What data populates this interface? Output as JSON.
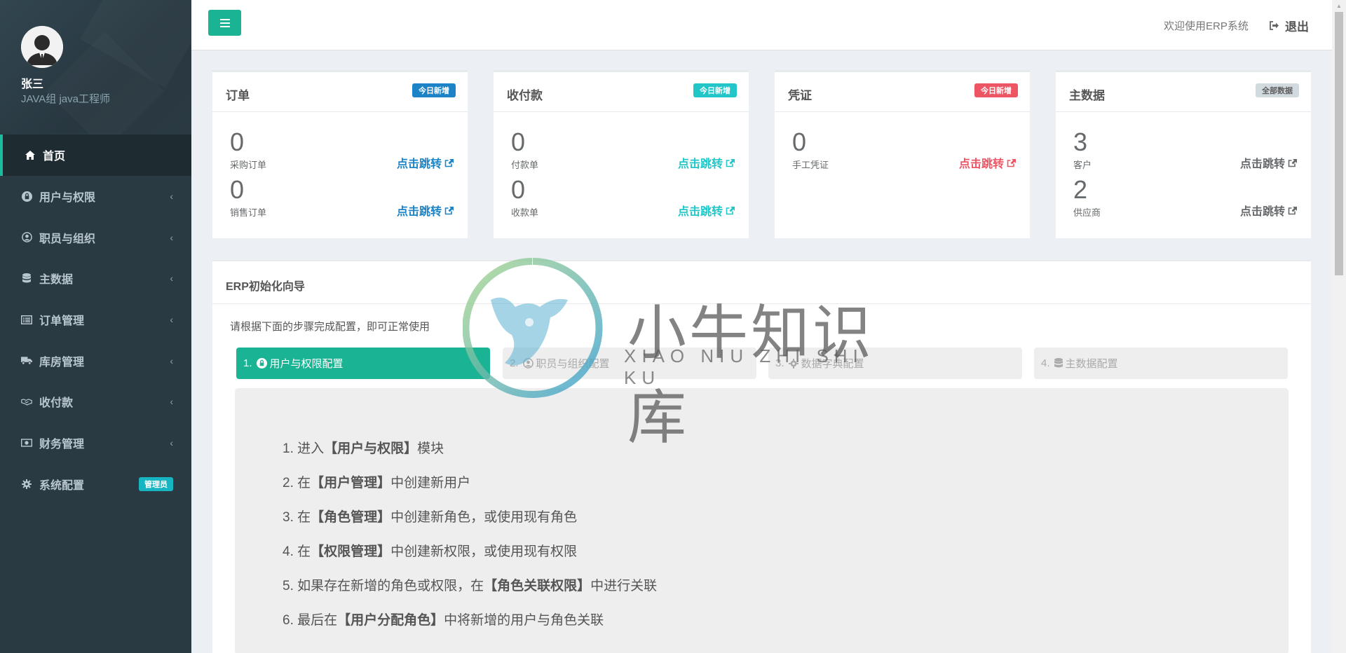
{
  "user": {
    "name": "张三",
    "role": "JAVA组 java工程师"
  },
  "sidebar": {
    "items": [
      {
        "label": "首页",
        "icon": "home-icon",
        "active": true
      },
      {
        "label": "用户与权限",
        "icon": "lock-icon"
      },
      {
        "label": "职员与组织",
        "icon": "user-circle-icon"
      },
      {
        "label": "主数据",
        "icon": "database-icon"
      },
      {
        "label": "订单管理",
        "icon": "list-alt-icon"
      },
      {
        "label": "库房管理",
        "icon": "truck-icon"
      },
      {
        "label": "收付款",
        "icon": "handshake-icon"
      },
      {
        "label": "财务管理",
        "icon": "money-icon"
      },
      {
        "label": "系统配置",
        "icon": "gear-icon",
        "badge": "管理员"
      }
    ]
  },
  "header": {
    "welcome": "欢迎使用ERP系统",
    "logout": "退出"
  },
  "boxes": [
    {
      "title": "订单",
      "badge": "今日新增",
      "badge_color": "#1c84c6",
      "link_color": "#1c84c6",
      "stats": [
        {
          "num": "0",
          "label": "采购订单",
          "link": "点击跳转"
        },
        {
          "num": "0",
          "label": "销售订单",
          "link": "点击跳转"
        }
      ]
    },
    {
      "title": "收付款",
      "badge": "今日新增",
      "badge_color": "#23c6c8",
      "link_color": "#23c6c8",
      "stats": [
        {
          "num": "0",
          "label": "付款单",
          "link": "点击跳转"
        },
        {
          "num": "0",
          "label": "收款单",
          "link": "点击跳转"
        }
      ]
    },
    {
      "title": "凭证",
      "badge": "今日新增",
      "badge_color": "#ed5565",
      "link_color": "#ed5565",
      "stats": [
        {
          "num": "0",
          "label": "手工凭证",
          "link": "点击跳转"
        }
      ]
    },
    {
      "title": "主数据",
      "badge": "全部数据",
      "badge_color": "#d1dade",
      "link_color": "#676a6c",
      "stats": [
        {
          "num": "3",
          "label": "客户",
          "link": "点击跳转"
        },
        {
          "num": "2",
          "label": "供应商",
          "link": "点击跳转"
        }
      ]
    }
  ],
  "wizard": {
    "title": "ERP初始化向导",
    "desc": "请根据下面的步骤完成配置，即可正常使用",
    "steps": [
      {
        "num": "1.",
        "label": "用户与权限配置",
        "icon": "lock-icon"
      },
      {
        "num": "2.",
        "label": "职员与组织配置",
        "icon": "user-circle-icon"
      },
      {
        "num": "3.",
        "label": "数据字典配置",
        "icon": "gear-icon"
      },
      {
        "num": "4.",
        "label": "主数据配置",
        "icon": "database-icon"
      }
    ],
    "instructions": [
      {
        "pre": "1. 进入",
        "bold": "【用户与权限】",
        "post": "模块"
      },
      {
        "pre": "2. 在",
        "bold": "【用户管理】",
        "post": "中创建新用户"
      },
      {
        "pre": "3. 在",
        "bold": "【角色管理】",
        "post": "中创建新角色，或使用现有角色"
      },
      {
        "pre": "4. 在",
        "bold": "【权限管理】",
        "post": "中创建新权限，或使用现有权限"
      },
      {
        "pre": "5. 如果存在新增的角色或权限，在",
        "bold": "【角色关联权限】",
        "post": "中进行关联"
      },
      {
        "pre": "6. 最后在",
        "bold": "【用户分配角色】",
        "post": "中将新增的用户与角色关联"
      }
    ]
  },
  "watermark": {
    "text": "小牛知识库",
    "sub": "XIAO NIU ZHI SHI KU"
  }
}
